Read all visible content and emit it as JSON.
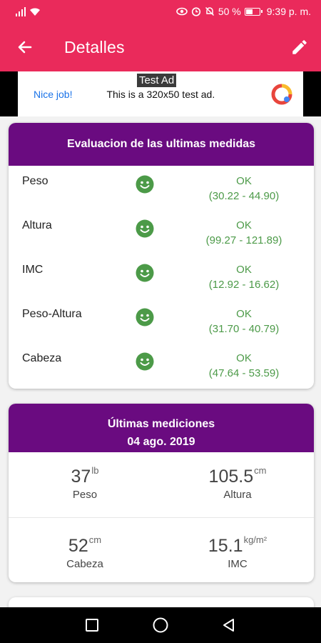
{
  "status_bar": {
    "battery": "50 %",
    "battery_level": 0.5,
    "time": "9:39 p. m.",
    "icons": [
      "signal-icon",
      "wifi-icon",
      "eye-icon",
      "alarm-icon",
      "mute-icon",
      "battery-icon"
    ]
  },
  "app_bar": {
    "title": "Detalles",
    "back_icon": "back-arrow-icon",
    "edit_icon": "edit-pencil-icon",
    "color": "#ea2a5b"
  },
  "ad": {
    "label": "Test Ad",
    "left_text": "Nice job!",
    "text": "This is a 320x50 test ad."
  },
  "evaluation": {
    "title": "Evaluacion de las ultimas medidas",
    "header_color": "#6a0b80",
    "status_color": "#4c9a48",
    "rows": [
      {
        "name": "Peso",
        "status": "OK",
        "range": "(30.22 - 44.90)"
      },
      {
        "name": "Altura",
        "status": "OK",
        "range": "(99.27 - 121.89)"
      },
      {
        "name": "IMC",
        "status": "OK",
        "range": "(12.92 - 16.62)"
      },
      {
        "name": "Peso-Altura",
        "status": "OK",
        "range": "(31.70 - 40.79)"
      },
      {
        "name": "Cabeza",
        "status": "OK",
        "range": "(47.64 - 53.59)"
      }
    ]
  },
  "measurements": {
    "title": "Últimas mediciones",
    "date": "04 ago. 2019",
    "items": [
      {
        "value": "37",
        "unit": "lb",
        "label": "Peso"
      },
      {
        "value": "105.5",
        "unit": "cm",
        "label": "Altura"
      },
      {
        "value": "52",
        "unit": "cm",
        "label": "Cabeza"
      },
      {
        "value": "15.1",
        "unit": "kg/m²",
        "label": "IMC"
      }
    ]
  },
  "nav_bar": {
    "icons": [
      "recent-apps-icon",
      "home-icon",
      "back-triangle-icon"
    ]
  }
}
